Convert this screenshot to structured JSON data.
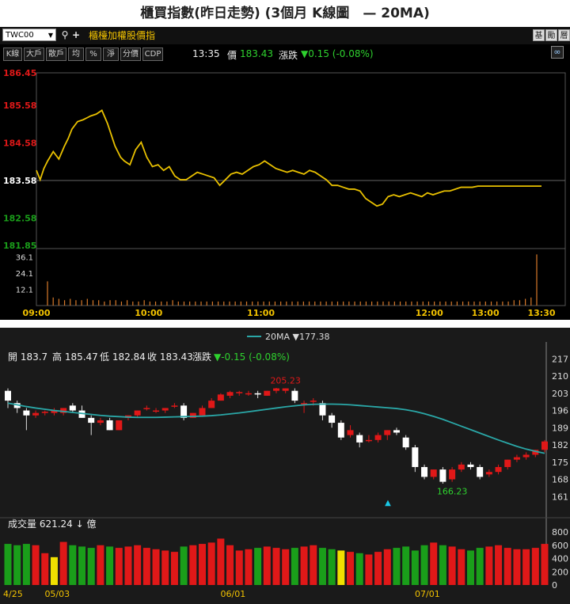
{
  "page_title": "櫃買指數(昨日走勢) (3個月 K線圖　— 20MA)",
  "toolbar": {
    "symbol": "TWC00",
    "index_name": "櫃檯加權股價指",
    "right_buttons": [
      "基",
      "勵",
      "層"
    ],
    "range_buttons": [
      "K線",
      "大戶",
      "散戶",
      "均",
      "%",
      "淨",
      "分價",
      "CDP"
    ]
  },
  "quote": {
    "time": "13:35",
    "price_label": "價",
    "price": "183.43",
    "change_label": "漲跌",
    "change": "▼0.15 (-0.08%)"
  },
  "colors": {
    "up": "#e01818",
    "down": "#1a9e1a",
    "intraday_line": "#e8c000",
    "ma_line": "#2aa7a7",
    "volume_highlight": "#f0e000"
  },
  "chart_data": [
    {
      "type": "line",
      "title": "",
      "x_ticks": [
        "09:00",
        "10:00",
        "11:00",
        "12:00",
        "13:00",
        "13:30"
      ],
      "y_ticks": [
        "186.45",
        "185.58",
        "184.58",
        "183.58",
        "182.58",
        "181.85"
      ],
      "y_tick_colors": [
        "#e01818",
        "#e01818",
        "#e01818",
        "#ffffff",
        "#1a9e1a",
        "#1a9e1a"
      ],
      "ylim": [
        181.85,
        186.45
      ],
      "reference": 183.58,
      "x_minutes": [
        0,
        2,
        4,
        6,
        9,
        12,
        15,
        17,
        19,
        22,
        25,
        27,
        29,
        32,
        35,
        38,
        40,
        42,
        45,
        47,
        50,
        53,
        56,
        59,
        62,
        65,
        68,
        71,
        74,
        77,
        80,
        83,
        86,
        89,
        92,
        95,
        98,
        101,
        104,
        107,
        110,
        113,
        116,
        119,
        122,
        125,
        128,
        131,
        134,
        137,
        140,
        143,
        146,
        149,
        152,
        155,
        158,
        161,
        164,
        167,
        170,
        173,
        176,
        179,
        182,
        185,
        188,
        191,
        194,
        197,
        200,
        203,
        206,
        209,
        212,
        215,
        218,
        221,
        224,
        227,
        230,
        233,
        236,
        240,
        244,
        248,
        252,
        256,
        260,
        265,
        270
      ],
      "series": [
        {
          "name": "",
          "values": [
            183.85,
            183.6,
            183.9,
            184.1,
            184.35,
            184.15,
            184.5,
            184.7,
            184.95,
            185.15,
            185.2,
            185.25,
            185.3,
            185.35,
            185.45,
            185.1,
            184.8,
            184.5,
            184.2,
            184.1,
            184.0,
            184.4,
            184.6,
            184.2,
            183.95,
            184.0,
            183.85,
            183.95,
            183.7,
            183.6,
            183.6,
            183.7,
            183.8,
            183.75,
            183.7,
            183.65,
            183.45,
            183.6,
            183.75,
            183.8,
            183.75,
            183.85,
            183.95,
            184.0,
            184.1,
            184.0,
            183.9,
            183.85,
            183.8,
            183.85,
            183.8,
            183.75,
            183.85,
            183.8,
            183.7,
            183.6,
            183.45,
            183.45,
            183.4,
            183.35,
            183.35,
            183.3,
            183.1,
            183.0,
            182.9,
            182.95,
            183.15,
            183.2,
            183.15,
            183.2,
            183.25,
            183.2,
            183.15,
            183.25,
            183.2,
            183.25,
            183.3,
            183.3,
            183.35,
            183.4,
            183.4,
            183.4,
            183.43,
            183.43,
            183.43,
            183.43,
            183.43,
            183.43,
            183.43,
            183.43,
            183.43
          ]
        }
      ],
      "volume_ticks": [
        "36.1",
        "24.1",
        "12.1"
      ],
      "volume_ylim": [
        0,
        40
      ],
      "volume_values": [
        18,
        6,
        5,
        4,
        5,
        4,
        4,
        5,
        4,
        4,
        3,
        4,
        4,
        3,
        4,
        3,
        3,
        4,
        3,
        3,
        3,
        3,
        4,
        3,
        3,
        3,
        3,
        3,
        3,
        3,
        3,
        3,
        3,
        3,
        3,
        3,
        3,
        3,
        3,
        3,
        3,
        3,
        3,
        3,
        3,
        3,
        3,
        3,
        3,
        3,
        3,
        3,
        3,
        3,
        3,
        3,
        3,
        3,
        3,
        3,
        3,
        3,
        3,
        3,
        3,
        3,
        3,
        3,
        3,
        3,
        3,
        3,
        3,
        3,
        3,
        3,
        3,
        3,
        3,
        3,
        3,
        3,
        4,
        4,
        5,
        6,
        38
      ]
    },
    {
      "type": "candlestick",
      "title": "",
      "legend": "20MA ▼177.38",
      "ohlc_summary": {
        "open_label": "開",
        "open": "183.7",
        "high_label": "高",
        "high": "185.47",
        "low_label": "低",
        "low": "182.84",
        "close_label": "收",
        "close": "183.43",
        "chg_label": "漲跌",
        "chg": "▼-0.15 (-0.08%)"
      },
      "y_ticks": [
        217,
        210,
        203,
        196,
        189,
        182,
        175,
        168,
        161
      ],
      "ylim": [
        154,
        220
      ],
      "x_ticks": [
        "4/25",
        "05/03",
        "06/01",
        "07/01"
      ],
      "x_tick_index": [
        0,
        5,
        24,
        45
      ],
      "annotations": [
        {
          "text": "205.23",
          "index": 30
        },
        {
          "text": "166.23",
          "index": 48
        }
      ],
      "candles": [
        {
          "o": 204,
          "h": 205,
          "l": 197,
          "c": 200
        },
        {
          "o": 199,
          "h": 200,
          "l": 195,
          "c": 197
        },
        {
          "o": 196,
          "h": 197,
          "l": 188,
          "c": 194
        },
        {
          "o": 194,
          "h": 196,
          "l": 193,
          "c": 195
        },
        {
          "o": 195,
          "h": 196,
          "l": 194,
          "c": 195.5
        },
        {
          "o": 195,
          "h": 197,
          "l": 194,
          "c": 196
        },
        {
          "o": 195,
          "h": 197,
          "l": 194,
          "c": 197
        },
        {
          "o": 198,
          "h": 199,
          "l": 195,
          "c": 196
        },
        {
          "o": 196,
          "h": 198,
          "l": 193,
          "c": 193
        },
        {
          "o": 193,
          "h": 194,
          "l": 186,
          "c": 191
        },
        {
          "o": 191,
          "h": 193,
          "l": 190,
          "c": 192
        },
        {
          "o": 192,
          "h": 193,
          "l": 188,
          "c": 188
        },
        {
          "o": 188,
          "h": 192,
          "l": 188,
          "c": 192
        },
        {
          "o": 193,
          "h": 194,
          "l": 192,
          "c": 194
        },
        {
          "o": 194,
          "h": 196,
          "l": 193,
          "c": 196
        },
        {
          "o": 197,
          "h": 198,
          "l": 196,
          "c": 197
        },
        {
          "o": 196,
          "h": 197,
          "l": 195,
          "c": 196
        },
        {
          "o": 196,
          "h": 197,
          "l": 195,
          "c": 197
        },
        {
          "o": 198,
          "h": 199,
          "l": 197,
          "c": 198
        },
        {
          "o": 198,
          "h": 199,
          "l": 192,
          "c": 193
        },
        {
          "o": 193,
          "h": 195,
          "l": 193,
          "c": 195
        },
        {
          "o": 194,
          "h": 198,
          "l": 194,
          "c": 197
        },
        {
          "o": 197,
          "h": 201,
          "l": 197,
          "c": 200
        },
        {
          "o": 200,
          "h": 203,
          "l": 200,
          "c": 202.5
        },
        {
          "o": 202,
          "h": 204,
          "l": 201,
          "c": 203.5
        },
        {
          "o": 203,
          "h": 204,
          "l": 202,
          "c": 203.5
        },
        {
          "o": 203,
          "h": 204,
          "l": 202,
          "c": 203
        },
        {
          "o": 203,
          "h": 204,
          "l": 201,
          "c": 202.5
        },
        {
          "o": 202,
          "h": 204,
          "l": 202,
          "c": 204
        },
        {
          "o": 204,
          "h": 205.2,
          "l": 203,
          "c": 205
        },
        {
          "o": 204,
          "h": 205,
          "l": 203,
          "c": 205
        },
        {
          "o": 204,
          "h": 205,
          "l": 199,
          "c": 200
        },
        {
          "o": 199,
          "h": 200,
          "l": 195,
          "c": 199
        },
        {
          "o": 200,
          "h": 201,
          "l": 198,
          "c": 200
        },
        {
          "o": 199,
          "h": 200,
          "l": 192,
          "c": 194
        },
        {
          "o": 194,
          "h": 195,
          "l": 189,
          "c": 191
        },
        {
          "o": 191,
          "h": 192,
          "l": 184,
          "c": 185
        },
        {
          "o": 186,
          "h": 190,
          "l": 185,
          "c": 188
        },
        {
          "o": 186,
          "h": 187,
          "l": 181,
          "c": 183
        },
        {
          "o": 184,
          "h": 186,
          "l": 183,
          "c": 184
        },
        {
          "o": 184,
          "h": 187,
          "l": 183,
          "c": 186
        },
        {
          "o": 186,
          "h": 188,
          "l": 184,
          "c": 188
        },
        {
          "o": 188,
          "h": 189,
          "l": 186,
          "c": 187
        },
        {
          "o": 185,
          "h": 186,
          "l": 180,
          "c": 181
        },
        {
          "o": 181,
          "h": 182,
          "l": 171,
          "c": 173
        },
        {
          "o": 173,
          "h": 174,
          "l": 168,
          "c": 169
        },
        {
          "o": 169,
          "h": 172,
          "l": 168,
          "c": 172
        },
        {
          "o": 172,
          "h": 173,
          "l": 166.23,
          "c": 167
        },
        {
          "o": 168,
          "h": 173,
          "l": 167,
          "c": 172
        },
        {
          "o": 172,
          "h": 175,
          "l": 171,
          "c": 174
        },
        {
          "o": 174,
          "h": 175,
          "l": 172,
          "c": 173
        },
        {
          "o": 173,
          "h": 174,
          "l": 168,
          "c": 169
        },
        {
          "o": 170,
          "h": 172,
          "l": 169,
          "c": 171
        },
        {
          "o": 171,
          "h": 174,
          "l": 170,
          "c": 173
        },
        {
          "o": 173,
          "h": 176,
          "l": 172,
          "c": 176
        },
        {
          "o": 176,
          "h": 178,
          "l": 175,
          "c": 177
        },
        {
          "o": 177,
          "h": 179,
          "l": 176,
          "c": 178
        },
        {
          "o": 178,
          "h": 180,
          "l": 177,
          "c": 180
        },
        {
          "o": 180,
          "h": 184,
          "l": 179,
          "c": 183.4
        }
      ],
      "ma20": [
        199,
        198.3,
        197.6,
        197,
        196.5,
        196,
        195.6,
        195.2,
        194.8,
        194.4,
        194,
        193.7,
        193.5,
        193.3,
        193.2,
        193.2,
        193.2,
        193.3,
        193.4,
        193.5,
        193.6,
        193.7,
        193.9,
        194.2,
        194.6,
        195,
        195.5,
        196,
        196.5,
        197,
        197.5,
        197.9,
        198.3,
        198.5,
        198.6,
        198.6,
        198.5,
        198.3,
        198,
        197.7,
        197.4,
        197.1,
        196.8,
        196.3,
        195.6,
        194.7,
        193.6,
        192.4,
        191,
        189.6,
        188.2,
        186.8,
        185.4,
        184,
        182.7,
        181.4,
        180.3,
        179.4,
        178.6
      ],
      "volume_ticks": [
        800,
        600,
        400,
        200,
        0
      ],
      "volume_ylim": [
        0,
        800
      ],
      "volume_label": "成交量 621.24 ↓ 億",
      "volume_values": [
        620,
        600,
        620,
        600,
        480,
        420,
        650,
        600,
        580,
        560,
        600,
        580,
        560,
        580,
        600,
        560,
        540,
        520,
        500,
        580,
        600,
        620,
        640,
        700,
        600,
        520,
        540,
        560,
        580,
        560,
        540,
        560,
        580,
        600,
        560,
        540,
        520,
        500,
        480,
        460,
        500,
        540,
        560,
        580,
        520,
        600,
        640,
        600,
        580,
        540,
        520,
        560,
        580,
        600,
        560,
        540,
        540,
        560,
        620
      ],
      "volume_yellow": [
        5,
        36
      ]
    }
  ]
}
